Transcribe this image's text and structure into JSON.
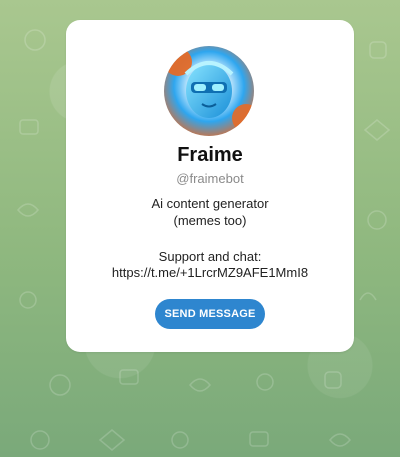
{
  "profile": {
    "name": "Fraime",
    "username": "@fraimebot",
    "description_lines": [
      "Ai content generator",
      "(memes too)"
    ],
    "support_lines": [
      "Support and chat:",
      "https://t.me/+1LrcrMZ9AFE1MmI8"
    ],
    "button_label": "SEND MESSAGE",
    "avatar_icon": "robot-face-avatar"
  },
  "colors": {
    "accent": "#2e86cf",
    "card": "#ffffff",
    "background": "#9fbf86"
  }
}
